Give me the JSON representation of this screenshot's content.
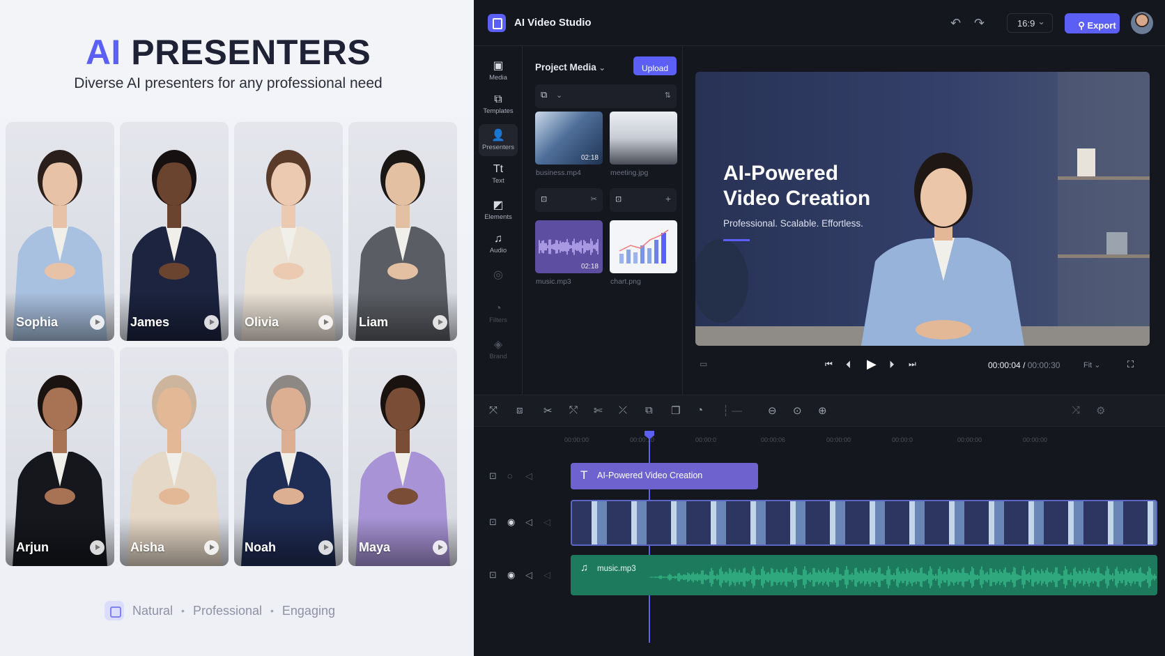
{
  "promo": {
    "title_accent": "AI",
    "title_rest": "PRESENTERS",
    "subtitle": "Diverse AI presenters for any professional need",
    "presenters": [
      {
        "name": "Sophia",
        "suit": "#a9c1e0",
        "skin": "#e7c2a6",
        "hair": "#2a1f1a"
      },
      {
        "name": "James",
        "suit": "#1c2440",
        "skin": "#6b4430",
        "hair": "#161010"
      },
      {
        "name": "Olivia",
        "suit": "#ece3d7",
        "skin": "#ecc9b1",
        "hair": "#5a3b2a"
      },
      {
        "name": "Liam",
        "suit": "#5a5d63",
        "skin": "#e4c0a3",
        "hair": "#1b1715"
      },
      {
        "name": "Arjun",
        "suit": "#15171d",
        "skin": "#a87355",
        "hair": "#1b1310"
      },
      {
        "name": "Aisha",
        "suit": "#e6d8c7",
        "skin": "#e3b896",
        "hair": "#cdb49c"
      },
      {
        "name": "Noah",
        "suit": "#1f2c54",
        "skin": "#dcaf92",
        "hair": "#8d8884"
      },
      {
        "name": "Maya",
        "suit": "#a793d6",
        "skin": "#7a4e36",
        "hair": "#1a120f"
      }
    ],
    "tags": [
      "Natural",
      "Professional",
      "Engaging"
    ],
    "separator": "•"
  },
  "app": {
    "title": "AI Video Studio",
    "ratio": "16:9",
    "export_label": "Export",
    "undo_icon": "undo-icon",
    "redo_icon": "redo-icon"
  },
  "rail": [
    {
      "label": "Media",
      "icon": "media-icon",
      "glyph": "▣",
      "active": false,
      "dim": false
    },
    {
      "label": "Templates",
      "icon": "templates-icon",
      "glyph": "⧉",
      "active": false,
      "dim": false
    },
    {
      "label": "Presenters",
      "icon": "presenters-icon",
      "glyph": "👤",
      "active": true,
      "dim": false
    },
    {
      "label": "Text",
      "icon": "text-icon",
      "glyph": "Tt",
      "active": false,
      "dim": false
    },
    {
      "label": "Elements",
      "icon": "elements-icon",
      "glyph": "◩",
      "active": false,
      "dim": false
    },
    {
      "label": "Audio",
      "icon": "audio-icon",
      "glyph": "♫",
      "active": false,
      "dim": false
    },
    {
      "label": "",
      "icon": "transitions-icon",
      "glyph": "◎",
      "active": false,
      "dim": true
    },
    {
      "label": "Filters",
      "icon": "filters-icon",
      "glyph": "◔",
      "active": false,
      "dim": true
    },
    {
      "label": "Brand",
      "icon": "brand-icon",
      "glyph": "◈",
      "active": false,
      "dim": true
    }
  ],
  "media": {
    "title": "Project Media",
    "upload_label": "Upload",
    "items": [
      {
        "name": "business.mp4",
        "duration": "02:18"
      },
      {
        "name": "meeting.jpg",
        "duration": ""
      },
      {
        "name": "music.mp3",
        "duration": "02:18"
      },
      {
        "name": "chart.png",
        "duration": ""
      }
    ]
  },
  "preview": {
    "headline": "AI-Powered Video Creation",
    "tagline": "Professional. Scalable. Effortless.",
    "current_time": "00:00:04",
    "total_time": "00:00:30",
    "time_separator": "/",
    "fit_label": "Fit"
  },
  "timeline": {
    "ruler": [
      "00:00:00",
      "00:00:10",
      "00:00:0",
      "00:00:06",
      "00:00:00",
      "00:00:0",
      "00:00:00",
      "00:00:00"
    ],
    "text_clip": "AI-Powered Video Creation",
    "audio_clip": "music.mp3",
    "playhead_progress": 0.133
  },
  "colors": {
    "accent": "#5b5ff6",
    "audio_clip": "#1e7a5c",
    "text_clip": "#6e62cf"
  }
}
